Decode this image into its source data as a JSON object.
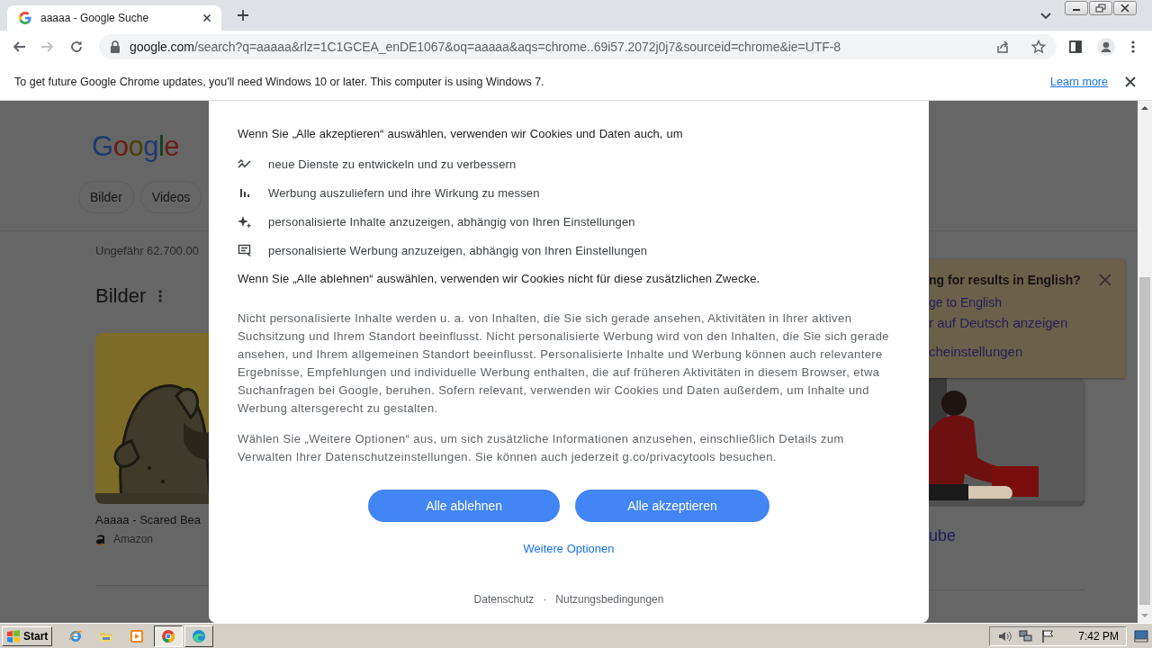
{
  "tabs": [
    {
      "title": "aaaaa - Google Suche",
      "selected": true
    }
  ],
  "nav": [
    {
      "kind": "back",
      "disabled": false
    },
    {
      "kind": "forward",
      "disabled": true
    },
    {
      "kind": "reload",
      "disabled": false
    }
  ],
  "address": {
    "host": "google.com",
    "path": "/search?q=aaaaa&rlz=1C1GCEA_enDE1067&oq=aaaaa&aqs=chrome..69i57.2072j0j7&sourceid=chrome&ie=UTF-8"
  },
  "infobar": {
    "message": "To get future Google Chrome updates, you'll need Windows 10 or later. This computer is using Windows 7.",
    "link": "Learn more"
  },
  "page": {
    "logo": "Google",
    "chips": [
      "Bilder",
      "Videos"
    ],
    "result_count": "Ungefähr 62.700.00",
    "section_title": "Bilder",
    "image_result": {
      "title": "Aaaaa - Scared Bea",
      "source": "Amazon"
    },
    "language_box": {
      "title": "ng for results in English?",
      "links": [
        "ge to English",
        "r auf Deutsch anzeigen",
        "cheinstellungen"
      ]
    },
    "video_result": {
      "title": "ube"
    }
  },
  "consent_dialog": {
    "intro": "Wenn Sie „Alle akzeptieren“ auswählen, verwenden wir Cookies und Daten auch, um",
    "purposes": [
      {
        "kind": "trend",
        "text": "neue Dienste zu entwickeln und zu verbessern"
      },
      {
        "kind": "bars",
        "text": "Werbung auszuliefern und ihre Wirkung zu messen"
      },
      {
        "kind": "sparkle",
        "text": "personalisierte Inhalte anzuzeigen, abhängig von Ihren Einstellungen"
      },
      {
        "kind": "ad",
        "text": "personalisierte Werbung anzuzeigen, abhängig von Ihren Einstellungen"
      }
    ],
    "decline_note": "Wenn Sie „Alle ablehnen“ auswählen, verwenden wir Cookies nicht für diese zusätzlichen Zwecke.",
    "paragraphs": [
      "Nicht personalisierte Inhalte werden u. a. von Inhalten, die Sie sich gerade ansehen, Aktivitäten in Ihrer aktiven Suchsitzung und Ihrem Standort beeinflusst. Nicht personalisierte Werbung wird von den Inhalten, die Sie sich gerade ansehen, und Ihrem allgemeinen Standort beeinflusst. Personalisierte Inhalte und Werbung können auch relevantere Ergebnisse, Empfehlungen und individuelle Werbung enthalten, die auf früheren Aktivitäten in diesem Browser, etwa Suchanfragen bei Google, beruhen. Sofern relevant, verwenden wir Cookies und Daten außerdem, um Inhalte und Werbung altersgerecht zu gestalten.",
      "Wählen Sie „Weitere Optionen“ aus, um sich zusätzliche Informationen anzusehen, einschließlich Details zum Verwalten Ihrer Datenschutzeinstellungen. Sie können auch jederzeit g.co/privacytools besuchen."
    ],
    "buttons": [
      "Alle ablehnen",
      "Alle akzeptieren"
    ],
    "more_options": "Weitere Optionen",
    "footer_links": [
      "Datenschutz",
      "Nutzungsbedingungen"
    ],
    "footer_separator": "·"
  },
  "taskbar": {
    "start": "Start",
    "quick_launch": [
      {
        "kind": "ie"
      },
      {
        "kind": "folder"
      },
      {
        "kind": "media"
      }
    ],
    "tasks": [
      {
        "kind": "chrome",
        "selected": true
      },
      {
        "kind": "edge",
        "selected": false
      }
    ],
    "clock": "7:42 PM"
  }
}
